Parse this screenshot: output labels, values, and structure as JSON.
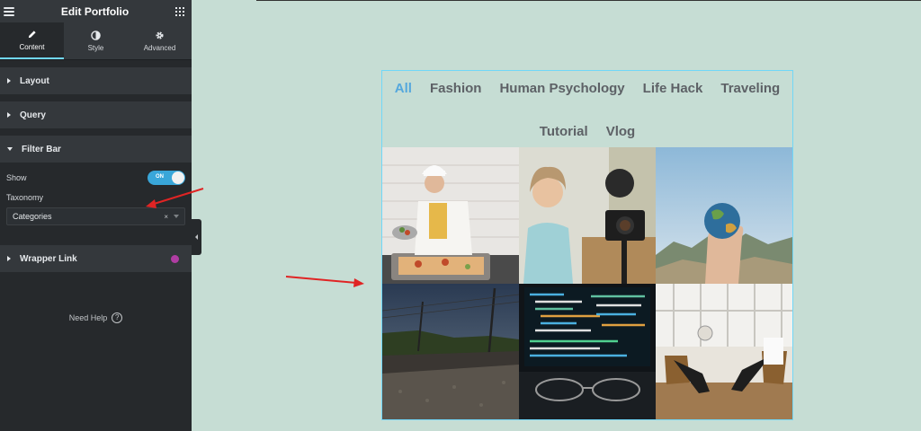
{
  "editor": {
    "title": "Edit Portfolio",
    "tabs": [
      {
        "label": "Content",
        "icon": "pencil-icon"
      },
      {
        "label": "Style",
        "icon": "half-circle-icon"
      },
      {
        "label": "Advanced",
        "icon": "gear-icon"
      }
    ],
    "sections": {
      "layout": "Layout",
      "query": "Query",
      "filter_bar": "Filter Bar",
      "wrapper_link": "Wrapper Link"
    },
    "filter_bar": {
      "show_label": "Show",
      "toggle_text": "ON",
      "taxonomy_label": "Taxonomy",
      "taxonomy_value": "Categories",
      "clear_symbol": "×"
    },
    "need_help": "Need Help",
    "help_symbol": "?"
  },
  "portfolio": {
    "filters": [
      "All",
      "Fashion",
      "Human Psychology",
      "Life Hack",
      "Traveling",
      "Tutorial",
      "Vlog"
    ],
    "active_filter": "All",
    "accent_color": "#55a8dd",
    "toggle_on_color": "#39a6d9"
  }
}
